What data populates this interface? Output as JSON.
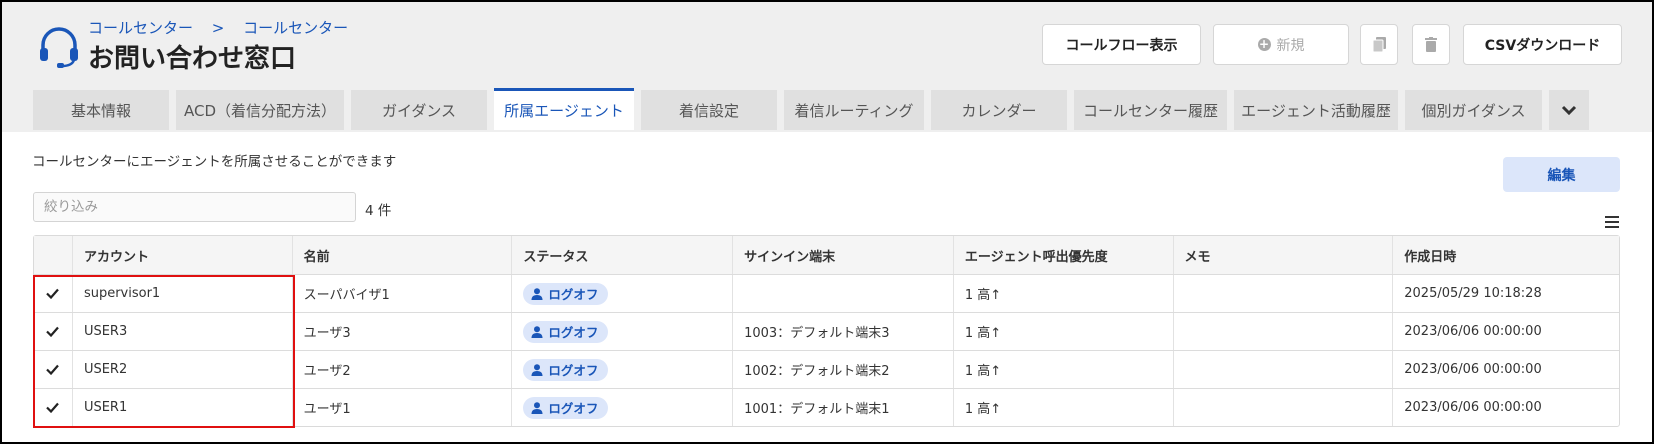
{
  "breadcrumb": {
    "item1": "コールセンター",
    "separator": ">",
    "item2": "コールセンター"
  },
  "page_title": "お問い合わせ窓口",
  "toolbar": {
    "callflow_label": "コールフロー表示",
    "new_label": "新規",
    "download_label": "CSVダウンロード"
  },
  "tabs": [
    {
      "label": "基本情報"
    },
    {
      "label": "ACD（着信分配方法）"
    },
    {
      "label": "ガイダンス"
    },
    {
      "label": "所属エージェント"
    },
    {
      "label": "着信設定"
    },
    {
      "label": "着信ルーティング"
    },
    {
      "label": "カレンダー"
    },
    {
      "label": "コールセンター履歴"
    },
    {
      "label": "エージェント活動履歴"
    },
    {
      "label": "個別ガイダンス"
    }
  ],
  "active_tab": "所属エージェント",
  "description": "コールセンターにエージェントを所属させることができます",
  "edit_label": "編集",
  "filter": {
    "placeholder": "絞り込み",
    "value": ""
  },
  "count_label": "4 件",
  "table": {
    "headers": [
      "アカウント",
      "名前",
      "ステータス",
      "サインイン端末",
      "エージェント呼出優先度",
      "メモ",
      "作成日時"
    ],
    "rows": [
      {
        "checked": true,
        "account": "supervisor1",
        "name": "スーパバイザ1",
        "status": "ログオフ",
        "device": "",
        "priority": "1 高↑",
        "memo": "",
        "created": "2025/05/29 10:18:28"
      },
      {
        "checked": true,
        "account": "USER3",
        "name": "ユーザ3",
        "status": "ログオフ",
        "device": "1003：デフォルト端末3",
        "priority": "1 高↑",
        "memo": "",
        "created": "2023/06/06 00:00:00"
      },
      {
        "checked": true,
        "account": "USER2",
        "name": "ユーザ2",
        "status": "ログオフ",
        "device": "1002：デフォルト端末2",
        "priority": "1 高↑",
        "memo": "",
        "created": "2023/06/06 00:00:00"
      },
      {
        "checked": true,
        "account": "USER1",
        "name": "ユーザ1",
        "status": "ログオフ",
        "device": "1001：デフォルト端末1",
        "priority": "1 高↑",
        "memo": "",
        "created": "2023/06/06 00:00:00"
      }
    ]
  },
  "colors": {
    "accent": "#1a56b8",
    "pill_bg": "#dce6fa",
    "highlight": "#e01010",
    "header_bg": "#efefef"
  },
  "icons": [
    "headset-icon",
    "plus-circle-icon",
    "copy-icon",
    "trash-icon",
    "chevron-down-icon",
    "menu-icon",
    "check-icon",
    "user-icon"
  ]
}
